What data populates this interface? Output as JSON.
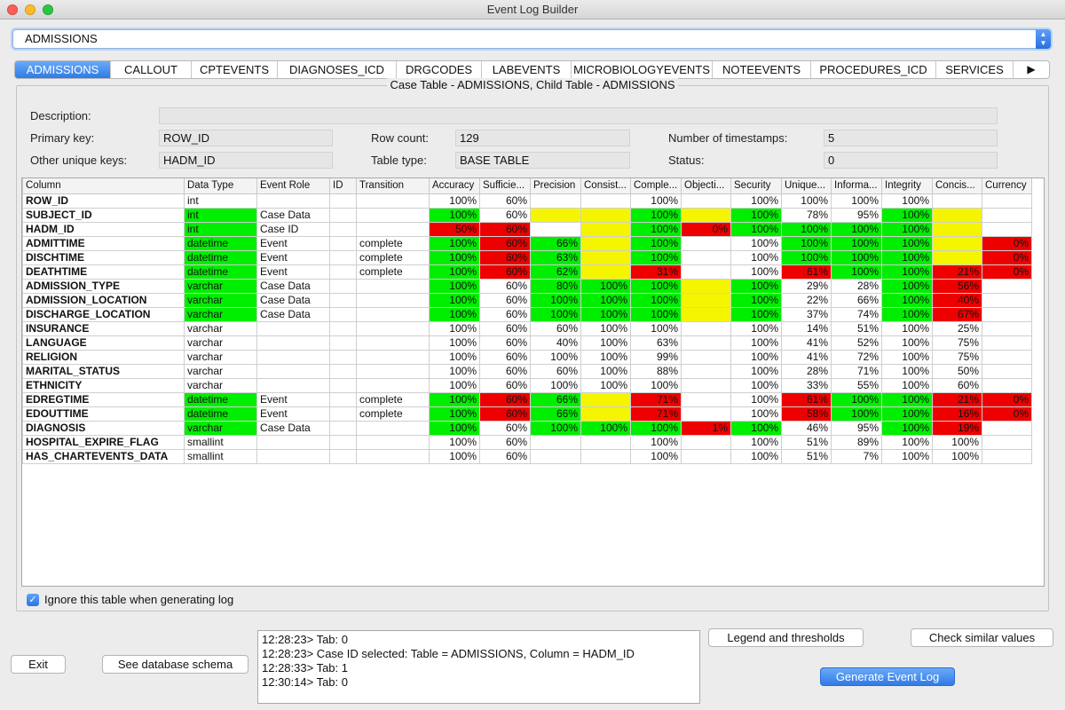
{
  "window": {
    "title": "Event Log Builder"
  },
  "table_select": {
    "value": "ADMISSIONS"
  },
  "tabs": [
    {
      "label": "ADMISSIONS",
      "active": true
    },
    {
      "label": "CALLOUT"
    },
    {
      "label": "CPTEVENTS"
    },
    {
      "label": "DIAGNOSES_ICD"
    },
    {
      "label": "DRGCODES"
    },
    {
      "label": "LABEVENTS"
    },
    {
      "label": "MICROBIOLOGYEVENTS"
    },
    {
      "label": "NOTEEVENTS"
    },
    {
      "label": "PROCEDURES_ICD"
    },
    {
      "label": "SERVICES"
    }
  ],
  "tab_next_icon": "triangle-right-icon",
  "panel": {
    "title": "Case Table - ADMISSIONS, Child Table - ADMISSIONS",
    "description_label": "Description:",
    "description_value": "",
    "primary_key_label": "Primary key:",
    "primary_key_value": "ROW_ID",
    "other_keys_label": "Other unique keys:",
    "other_keys_value": "HADM_ID",
    "row_count_label": "Row count:",
    "row_count_value": "129",
    "table_type_label": "Table type:",
    "table_type_value": "BASE TABLE",
    "timestamps_label": "Number of timestamps:",
    "timestamps_value": "5",
    "status_label": "Status:",
    "status_value": "0"
  },
  "colors": {
    "green": "#00ee00",
    "yellow": "#f5f500",
    "red": "#ee0000"
  },
  "grid": {
    "headers": [
      "Column",
      "Data Type",
      "Event Role",
      "ID",
      "Transition",
      "Accuracy",
      "Sufficie...",
      "Precision",
      "Consist...",
      "Comple...",
      "Objecti...",
      "Security",
      "Unique...",
      "Informa...",
      "Integrity",
      "Concis...",
      "Currency"
    ],
    "rows": [
      {
        "cells": [
          "ROW_ID",
          "int",
          "",
          "",
          "",
          "100%",
          "60%",
          "",
          "",
          "100%",
          "",
          "100%",
          "100%",
          "100%",
          "100%",
          "",
          ""
        ],
        "colors": [
          "",
          "",
          "",
          "",
          "",
          "",
          "",
          "",
          "",
          "",
          "",
          "",
          "",
          "",
          "",
          "",
          ""
        ]
      },
      {
        "cells": [
          "SUBJECT_ID",
          "int",
          "Case Data",
          "",
          "",
          "100%",
          "60%",
          "",
          "",
          "100%",
          "",
          "100%",
          "78%",
          "95%",
          "100%",
          "",
          ""
        ],
        "colors": [
          "",
          "g",
          "",
          "",
          "",
          "g",
          "",
          "y",
          "y",
          "g",
          "y",
          "g",
          "",
          "",
          "g",
          "y",
          ""
        ]
      },
      {
        "cells": [
          "HADM_ID",
          "int",
          "Case ID",
          "",
          "",
          "50%",
          "60%",
          "",
          "",
          "100%",
          "0%",
          "100%",
          "100%",
          "100%",
          "100%",
          "",
          ""
        ],
        "colors": [
          "",
          "g",
          "",
          "",
          "",
          "r",
          "r",
          "",
          "y",
          "g",
          "r",
          "g",
          "g",
          "g",
          "g",
          "y",
          ""
        ]
      },
      {
        "cells": [
          "ADMITTIME",
          "datetime",
          "Event",
          "",
          "complete",
          "100%",
          "60%",
          "66%",
          "",
          "100%",
          "",
          "100%",
          "100%",
          "100%",
          "100%",
          "",
          "0%"
        ],
        "colors": [
          "",
          "g",
          "",
          "",
          "",
          "g",
          "r",
          "g",
          "y",
          "g",
          "",
          "",
          "g",
          "g",
          "g",
          "y",
          "r"
        ]
      },
      {
        "cells": [
          "DISCHTIME",
          "datetime",
          "Event",
          "",
          "complete",
          "100%",
          "60%",
          "63%",
          "",
          "100%",
          "",
          "100%",
          "100%",
          "100%",
          "100%",
          "",
          "0%"
        ],
        "colors": [
          "",
          "g",
          "",
          "",
          "",
          "g",
          "r",
          "g",
          "y",
          "g",
          "",
          "",
          "g",
          "g",
          "g",
          "y",
          "r"
        ]
      },
      {
        "cells": [
          "DEATHTIME",
          "datetime",
          "Event",
          "",
          "complete",
          "100%",
          "60%",
          "62%",
          "",
          "31%",
          "",
          "100%",
          "61%",
          "100%",
          "100%",
          "21%",
          "0%"
        ],
        "colors": [
          "",
          "g",
          "",
          "",
          "",
          "g",
          "r",
          "g",
          "y",
          "r",
          "",
          "",
          "r",
          "g",
          "g",
          "r",
          "r"
        ]
      },
      {
        "cells": [
          "ADMISSION_TYPE",
          "varchar",
          "Case Data",
          "",
          "",
          "100%",
          "60%",
          "80%",
          "100%",
          "100%",
          "",
          "100%",
          "29%",
          "28%",
          "100%",
          "56%",
          ""
        ],
        "colors": [
          "",
          "g",
          "",
          "",
          "",
          "g",
          "",
          "g",
          "g",
          "g",
          "y",
          "g",
          "",
          "",
          "g",
          "r",
          ""
        ]
      },
      {
        "cells": [
          "ADMISSION_LOCATION",
          "varchar",
          "Case Data",
          "",
          "",
          "100%",
          "60%",
          "100%",
          "100%",
          "100%",
          "",
          "100%",
          "22%",
          "66%",
          "100%",
          "40%",
          ""
        ],
        "colors": [
          "",
          "g",
          "",
          "",
          "",
          "g",
          "",
          "g",
          "g",
          "g",
          "y",
          "g",
          "",
          "",
          "g",
          "r",
          ""
        ]
      },
      {
        "cells": [
          "DISCHARGE_LOCATION",
          "varchar",
          "Case Data",
          "",
          "",
          "100%",
          "60%",
          "100%",
          "100%",
          "100%",
          "",
          "100%",
          "37%",
          "74%",
          "100%",
          "67%",
          ""
        ],
        "colors": [
          "",
          "g",
          "",
          "",
          "",
          "g",
          "",
          "g",
          "g",
          "g",
          "y",
          "g",
          "",
          "",
          "g",
          "r",
          ""
        ]
      },
      {
        "cells": [
          "INSURANCE",
          "varchar",
          "",
          "",
          "",
          "100%",
          "60%",
          "60%",
          "100%",
          "100%",
          "",
          "100%",
          "14%",
          "51%",
          "100%",
          "25%",
          ""
        ],
        "colors": [
          "",
          "",
          "",
          "",
          "",
          "",
          "",
          "",
          "",
          "",
          "",
          "",
          "",
          "",
          "",
          "",
          ""
        ]
      },
      {
        "cells": [
          "LANGUAGE",
          "varchar",
          "",
          "",
          "",
          "100%",
          "60%",
          "40%",
          "100%",
          "63%",
          "",
          "100%",
          "41%",
          "52%",
          "100%",
          "75%",
          ""
        ],
        "colors": [
          "",
          "",
          "",
          "",
          "",
          "",
          "",
          "",
          "",
          "",
          "",
          "",
          "",
          "",
          "",
          "",
          ""
        ]
      },
      {
        "cells": [
          "RELIGION",
          "varchar",
          "",
          "",
          "",
          "100%",
          "60%",
          "100%",
          "100%",
          "99%",
          "",
          "100%",
          "41%",
          "72%",
          "100%",
          "75%",
          ""
        ],
        "colors": [
          "",
          "",
          "",
          "",
          "",
          "",
          "",
          "",
          "",
          "",
          "",
          "",
          "",
          "",
          "",
          "",
          ""
        ]
      },
      {
        "cells": [
          "MARITAL_STATUS",
          "varchar",
          "",
          "",
          "",
          "100%",
          "60%",
          "60%",
          "100%",
          "88%",
          "",
          "100%",
          "28%",
          "71%",
          "100%",
          "50%",
          ""
        ],
        "colors": [
          "",
          "",
          "",
          "",
          "",
          "",
          "",
          "",
          "",
          "",
          "",
          "",
          "",
          "",
          "",
          "",
          ""
        ]
      },
      {
        "cells": [
          "ETHNICITY",
          "varchar",
          "",
          "",
          "",
          "100%",
          "60%",
          "100%",
          "100%",
          "100%",
          "",
          "100%",
          "33%",
          "55%",
          "100%",
          "60%",
          ""
        ],
        "colors": [
          "",
          "",
          "",
          "",
          "",
          "",
          "",
          "",
          "",
          "",
          "",
          "",
          "",
          "",
          "",
          "",
          ""
        ]
      },
      {
        "cells": [
          "EDREGTIME",
          "datetime",
          "Event",
          "",
          "complete",
          "100%",
          "60%",
          "66%",
          "",
          "71%",
          "",
          "100%",
          "61%",
          "100%",
          "100%",
          "21%",
          "0%"
        ],
        "colors": [
          "",
          "g",
          "",
          "",
          "",
          "g",
          "r",
          "g",
          "y",
          "r",
          "",
          "",
          "r",
          "g",
          "g",
          "r",
          "r"
        ]
      },
      {
        "cells": [
          "EDOUTTIME",
          "datetime",
          "Event",
          "",
          "complete",
          "100%",
          "60%",
          "66%",
          "",
          "71%",
          "",
          "100%",
          "58%",
          "100%",
          "100%",
          "16%",
          "0%"
        ],
        "colors": [
          "",
          "g",
          "",
          "",
          "",
          "g",
          "r",
          "g",
          "y",
          "r",
          "",
          "",
          "r",
          "g",
          "g",
          "r",
          "r"
        ]
      },
      {
        "cells": [
          "DIAGNOSIS",
          "varchar",
          "Case Data",
          "",
          "",
          "100%",
          "60%",
          "100%",
          "100%",
          "100%",
          "1%",
          "100%",
          "46%",
          "95%",
          "100%",
          "19%",
          ""
        ],
        "colors": [
          "",
          "g",
          "",
          "",
          "",
          "g",
          "",
          "g",
          "g",
          "g",
          "r",
          "g",
          "",
          "",
          "g",
          "r",
          ""
        ]
      },
      {
        "cells": [
          "HOSPITAL_EXPIRE_FLAG",
          "smallint",
          "",
          "",
          "",
          "100%",
          "60%",
          "",
          "",
          "100%",
          "",
          "100%",
          "51%",
          "89%",
          "100%",
          "100%",
          ""
        ],
        "colors": [
          "",
          "",
          "",
          "",
          "",
          "",
          "",
          "",
          "",
          "",
          "",
          "",
          "",
          "",
          "",
          "",
          ""
        ]
      },
      {
        "cells": [
          "HAS_CHARTEVENTS_DATA",
          "smallint",
          "",
          "",
          "",
          "100%",
          "60%",
          "",
          "",
          "100%",
          "",
          "100%",
          "51%",
          "7%",
          "100%",
          "100%",
          ""
        ],
        "colors": [
          "",
          "",
          "",
          "",
          "",
          "",
          "",
          "",
          "",
          "",
          "",
          "",
          "",
          "",
          "",
          "",
          ""
        ]
      }
    ]
  },
  "ignore_checkbox": {
    "label": "Ignore this table when generating log",
    "checked": true
  },
  "buttons": {
    "exit": "Exit",
    "schema": "See database schema",
    "legend": "Legend and thresholds",
    "similar": "Check similar values",
    "generate": "Generate Event Log"
  },
  "log_lines": [
    "12:28:23> Tab: 0",
    "12:28:23> Case ID selected: Table = ADMISSIONS, Column = HADM_ID",
    "12:28:33> Tab: 1",
    "12:30:14> Tab: 0"
  ]
}
